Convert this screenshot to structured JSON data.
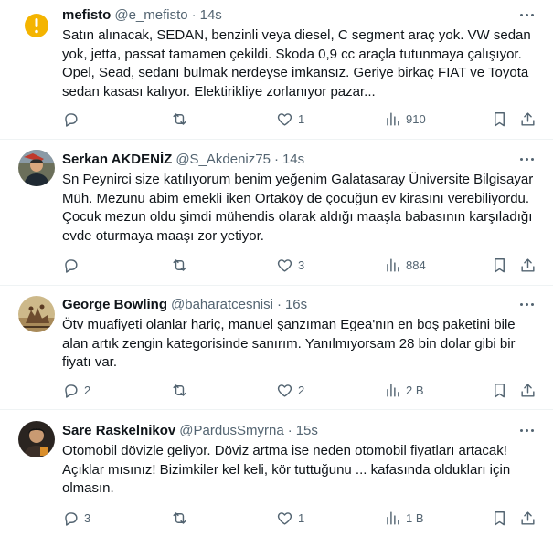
{
  "tweets": [
    {
      "name": "mefisto",
      "handle": "@e_mefisto",
      "dot": "·",
      "time": "14s",
      "text": "Satın alınacak, SEDAN, benzinli veya diesel, C segment araç yok. VW sedan yok, jetta, passat tamamen çekildi. Skoda 0,9 cc araçla tutunmaya çalışıyor. Opel, Sead, sedanı bulmak nerdeyse imkansız. Geriye birkaç FIAT ve Toyota sedan kasası kalıyor. Elektirikliye zorlanıyor pazar...",
      "replies": "",
      "retweets": "",
      "likes": "1",
      "views": "910",
      "avatar_color": "#f4b400"
    },
    {
      "name": "Serkan AKDENİZ",
      "handle": "@S_Akdeniz75",
      "dot": "·",
      "time": "14s",
      "text": "Sn Peynirci size katılıyorum benim yeğenim Galatasaray Üniversite Bilgisayar Müh. Mezunu abim emekli iken Ortaköy de çocuğun ev kirasını verebiliyordu. Çocuk mezun oldu şimdi mühendis olarak aldığı maaşla babasının  karşıladığı evde oturmaya maaşı zor yetiyor.",
      "replies": "",
      "retweets": "",
      "likes": "3",
      "views": "884"
    },
    {
      "name": "George Bowling",
      "handle": "@baharatcesnisi",
      "dot": "·",
      "time": "16s",
      "text": "Ötv muafiyeti olanlar hariç, manuel şanzıman Egea'nın en boş paketini bile alan artık zengin kategorisinde sanırım. Yanılmıyorsam 28 bin dolar gibi bir fiyatı var.",
      "replies": "2",
      "retweets": "",
      "likes": "2",
      "views": "2 B"
    },
    {
      "name": "Sare Raskelnikov",
      "handle": "@PardusSmyrna",
      "dot": "·",
      "time": "15s",
      "text": "Otomobil dövizle geliyor. Döviz artma ise neden otomobil fiyatları artacak! Açıklar mısınız! Bizimkiler kel keli, kör tuttuğunu ... kafasında oldukları için olmasın.",
      "replies": "3",
      "retweets": "",
      "likes": "1",
      "views": "1 B"
    }
  ],
  "icons": {
    "reply": "reply-icon",
    "retweet": "retweet-icon",
    "like": "heart-icon",
    "views": "views-bar-chart-icon",
    "bookmark": "bookmark-icon",
    "share": "share-icon",
    "more": "more-options-icon"
  },
  "colors": {
    "text": "#0f1419",
    "secondary": "#536471",
    "divider": "#eff3f4"
  }
}
